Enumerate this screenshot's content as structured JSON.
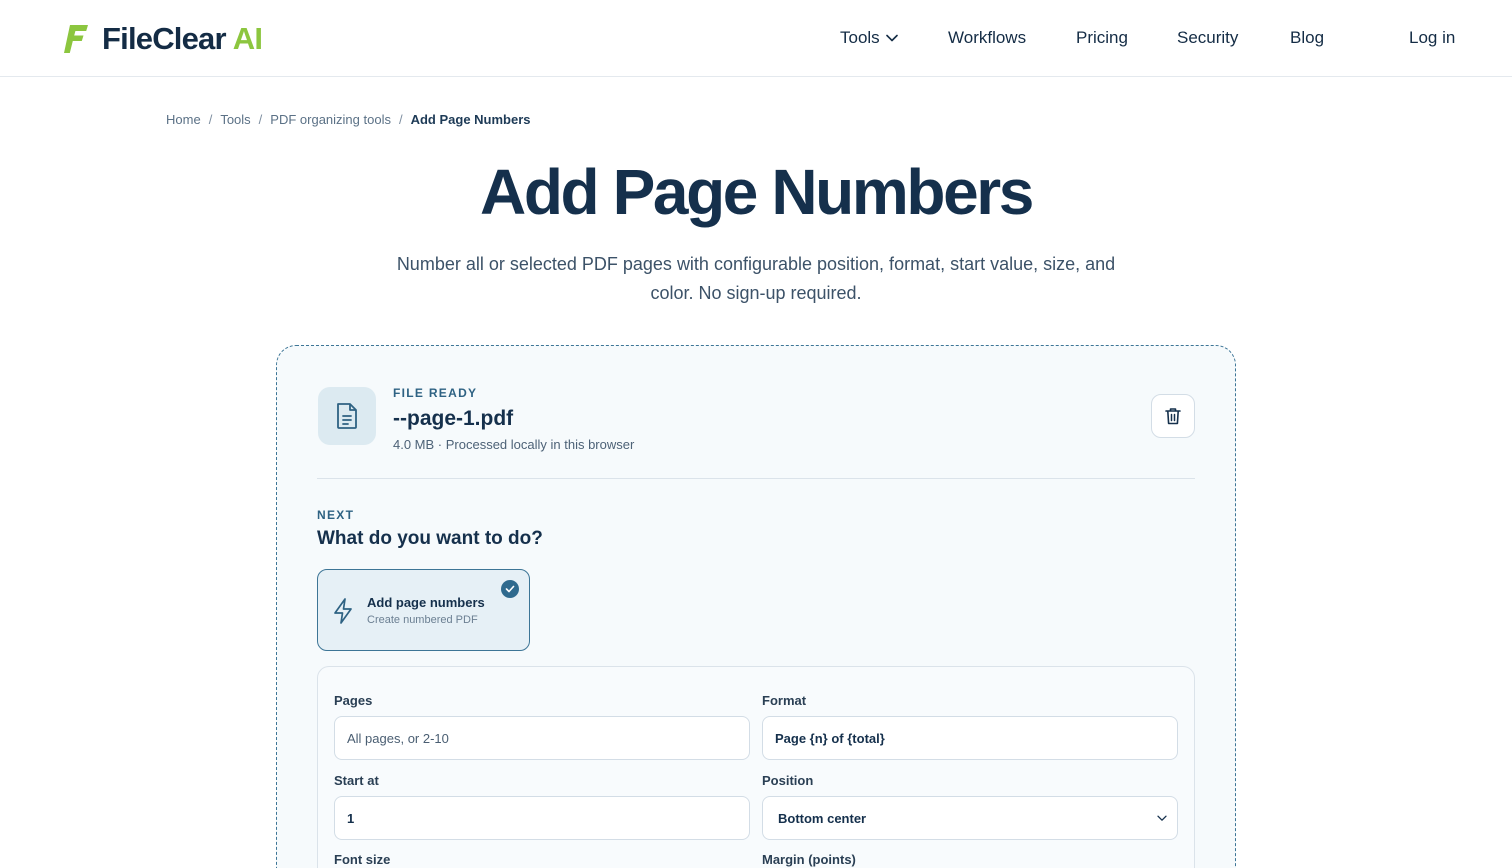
{
  "brand": {
    "name": "FileClear",
    "suffix": "AI",
    "logo_letter": "F",
    "accent_color": "#8cc63f",
    "primary_color": "#15304c"
  },
  "nav": {
    "tools": "Tools",
    "workflows": "Workflows",
    "pricing": "Pricing",
    "security": "Security",
    "blog": "Blog",
    "login": "Log in"
  },
  "breadcrumb": {
    "home": "Home",
    "tools": "Tools",
    "category": "PDF organizing tools",
    "current": "Add Page Numbers",
    "separator": "/"
  },
  "hero": {
    "title": "Add Page Numbers",
    "subtitle": "Number all or selected PDF pages with configurable position, format, start value, size, and color. No sign-up required."
  },
  "file": {
    "status": "FILE READY",
    "name": "--page-1.pdf",
    "meta": "4.0 MB · Processed locally in this browser",
    "file_icon": "document-icon",
    "delete_icon": "trash-icon"
  },
  "next_step": {
    "eyebrow": "NEXT",
    "question": "What do you want to do?",
    "action": {
      "title": "Add page numbers",
      "subtitle": "Create numbered PDF",
      "icon": "lightning-icon",
      "selected": true
    }
  },
  "options": {
    "pages": {
      "label": "Pages",
      "value": "",
      "placeholder": "All pages, or 2-10"
    },
    "format": {
      "label": "Format",
      "value": "Page {n} of {total}"
    },
    "start_at": {
      "label": "Start at",
      "value": "1"
    },
    "position": {
      "label": "Position",
      "value": "Bottom center"
    },
    "font_size": {
      "label": "Font size"
    },
    "margin": {
      "label": "Margin (points)"
    }
  }
}
